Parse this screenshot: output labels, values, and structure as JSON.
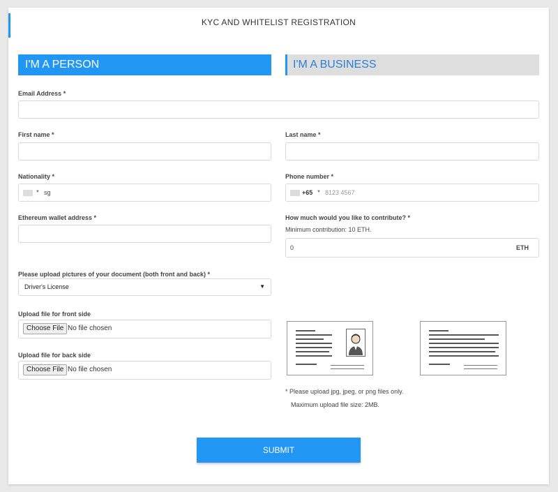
{
  "page": {
    "title": "KYC AND WHITELIST REGISTRATION"
  },
  "tabs": {
    "person": "I'M A PERSON",
    "business": "I'M A BUSINESS"
  },
  "form": {
    "email": {
      "label": "Email Address *",
      "value": ""
    },
    "first_name": {
      "label": "First name *",
      "value": ""
    },
    "last_name": {
      "label": "Last name *",
      "value": ""
    },
    "nationality": {
      "label": "Nationality *",
      "value": "sg"
    },
    "phone": {
      "label": "Phone number *",
      "code": "+65",
      "placeholder": "8123 4567"
    },
    "wallet": {
      "label": "Ethereum wallet address *",
      "value": ""
    },
    "contribution": {
      "label": "How much would you like to contribute? *",
      "note": "Minimum contribution: 10 ETH.",
      "value": "0",
      "unit": "ETH"
    },
    "document": {
      "label": "Please upload pictures of your document (both front and back) *",
      "selected": "Driver's License"
    },
    "front_upload": {
      "label": "Upload file for front side",
      "button": "Choose File",
      "status": "No file chosen"
    },
    "back_upload": {
      "label": "Upload file for back side",
      "button": "Choose File",
      "status": "No file chosen"
    }
  },
  "upload_notes": {
    "formats": "* Please upload jpg, jpeg, or png files only.",
    "max_size": "Maximum upload file size: 2MB."
  },
  "submit_label": "SUBMIT",
  "icons": {
    "dropdown": "caret-down-icon",
    "flag": "flag-icon",
    "document_front": "id-card-front-icon",
    "document_back": "id-card-back-icon",
    "person": "person-photo-icon"
  },
  "colors": {
    "accent": "#2196f3",
    "tab_inactive_bg": "#dedede",
    "tab_inactive_text": "#2a7fd6",
    "background": "#e9e9e9"
  }
}
